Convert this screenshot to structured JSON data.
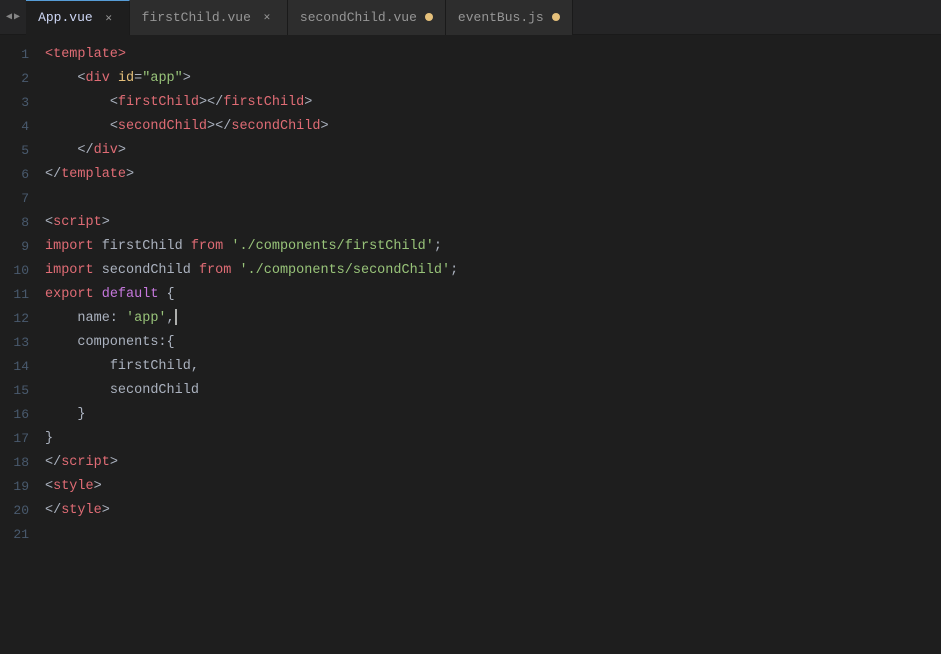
{
  "tabs": [
    {
      "id": "app-vue",
      "label": "App.vue",
      "active": true,
      "close": "x",
      "dot": false
    },
    {
      "id": "first-child-vue",
      "label": "firstChild.vue",
      "active": false,
      "close": "x",
      "dot": false
    },
    {
      "id": "second-child-vue",
      "label": "secondChild.vue",
      "active": false,
      "close": null,
      "dot": true
    },
    {
      "id": "event-bus-js",
      "label": "eventBus.js",
      "active": false,
      "close": null,
      "dot": true
    }
  ],
  "lines": [
    {
      "num": 1,
      "tokens": [
        {
          "t": "tag",
          "v": "<template>"
        }
      ]
    },
    {
      "num": 2,
      "tokens": [
        {
          "t": "indent",
          "v": "    "
        },
        {
          "t": "bracket",
          "v": "<"
        },
        {
          "t": "tag",
          "v": "div"
        },
        {
          "t": "bracket",
          "v": " "
        },
        {
          "t": "attr-name",
          "v": "id"
        },
        {
          "t": "bracket",
          "v": "="
        },
        {
          "t": "attr-value",
          "v": "\"app\""
        },
        {
          "t": "bracket",
          "v": ">"
        }
      ]
    },
    {
      "num": 3,
      "tokens": [
        {
          "t": "indent",
          "v": "        "
        },
        {
          "t": "bracket",
          "v": "<"
        },
        {
          "t": "tag",
          "v": "firstChild"
        },
        {
          "t": "bracket",
          "v": "></"
        },
        {
          "t": "tag",
          "v": "firstChild"
        },
        {
          "t": "bracket",
          "v": ">"
        }
      ]
    },
    {
      "num": 4,
      "tokens": [
        {
          "t": "indent",
          "v": "        "
        },
        {
          "t": "bracket",
          "v": "<"
        },
        {
          "t": "tag",
          "v": "secondChild"
        },
        {
          "t": "bracket",
          "v": "></"
        },
        {
          "t": "tag",
          "v": "secondChild"
        },
        {
          "t": "bracket",
          "v": ">"
        }
      ]
    },
    {
      "num": 5,
      "tokens": [
        {
          "t": "indent",
          "v": "    "
        },
        {
          "t": "bracket",
          "v": "</"
        },
        {
          "t": "tag",
          "v": "div"
        },
        {
          "t": "bracket",
          "v": ">"
        }
      ]
    },
    {
      "num": 6,
      "tokens": [
        {
          "t": "bracket",
          "v": "</"
        },
        {
          "t": "tag",
          "v": "template"
        },
        {
          "t": "bracket",
          "v": ">"
        }
      ]
    },
    {
      "num": 7,
      "tokens": []
    },
    {
      "num": 8,
      "tokens": [
        {
          "t": "bracket",
          "v": "<"
        },
        {
          "t": "tag",
          "v": "script"
        },
        {
          "t": "bracket",
          "v": ">"
        }
      ]
    },
    {
      "num": 9,
      "tokens": [
        {
          "t": "keyword",
          "v": "import"
        },
        {
          "t": "text",
          "v": " firstChild "
        },
        {
          "t": "keyword",
          "v": "from"
        },
        {
          "t": "text",
          "v": " "
        },
        {
          "t": "string",
          "v": "'./components/firstChild'"
        },
        {
          "t": "text",
          "v": ";"
        }
      ]
    },
    {
      "num": 10,
      "tokens": [
        {
          "t": "keyword",
          "v": "import"
        },
        {
          "t": "text",
          "v": " secondChild "
        },
        {
          "t": "keyword",
          "v": "from"
        },
        {
          "t": "text",
          "v": " "
        },
        {
          "t": "string",
          "v": "'./components/secondChild'"
        },
        {
          "t": "text",
          "v": ";"
        }
      ]
    },
    {
      "num": 11,
      "tokens": [
        {
          "t": "keyword",
          "v": "export"
        },
        {
          "t": "text",
          "v": " "
        },
        {
          "t": "keyword-default",
          "v": "default"
        },
        {
          "t": "text",
          "v": " {"
        }
      ]
    },
    {
      "num": 12,
      "tokens": [
        {
          "t": "indent",
          "v": "    "
        },
        {
          "t": "text",
          "v": "name: "
        },
        {
          "t": "string",
          "v": "'app'"
        },
        {
          "t": "text",
          "v": ","
        },
        {
          "t": "cursor",
          "v": ""
        }
      ]
    },
    {
      "num": 13,
      "tokens": [
        {
          "t": "indent",
          "v": "    "
        },
        {
          "t": "text",
          "v": "components:{"
        }
      ]
    },
    {
      "num": 14,
      "tokens": [
        {
          "t": "indent",
          "v": "        "
        },
        {
          "t": "text",
          "v": "firstChild,"
        }
      ]
    },
    {
      "num": 15,
      "tokens": [
        {
          "t": "indent",
          "v": "        "
        },
        {
          "t": "text",
          "v": "secondChild"
        }
      ]
    },
    {
      "num": 16,
      "tokens": [
        {
          "t": "indent",
          "v": "    "
        },
        {
          "t": "text",
          "v": "}"
        }
      ]
    },
    {
      "num": 17,
      "tokens": [
        {
          "t": "text",
          "v": "}"
        }
      ]
    },
    {
      "num": 18,
      "tokens": [
        {
          "t": "bracket",
          "v": "</"
        },
        {
          "t": "tag",
          "v": "script"
        },
        {
          "t": "bracket",
          "v": ">"
        }
      ]
    },
    {
      "num": 19,
      "tokens": [
        {
          "t": "bracket",
          "v": "<"
        },
        {
          "t": "tag",
          "v": "style"
        },
        {
          "t": "bracket",
          "v": ">"
        }
      ]
    },
    {
      "num": 20,
      "tokens": [
        {
          "t": "bracket",
          "v": "</"
        },
        {
          "t": "tag",
          "v": "style"
        },
        {
          "t": "bracket",
          "v": ">"
        }
      ]
    },
    {
      "num": 21,
      "tokens": []
    }
  ]
}
